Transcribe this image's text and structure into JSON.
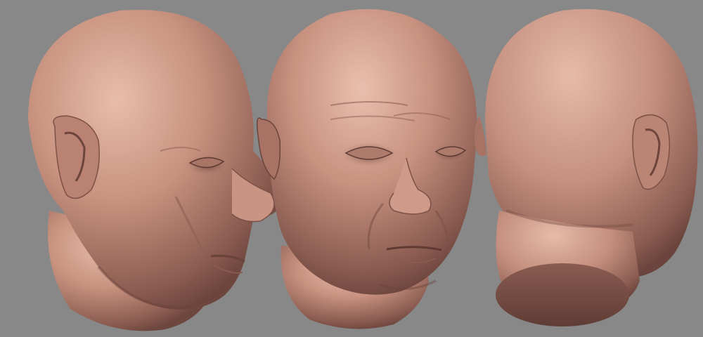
{
  "scene": {
    "background_color": "#888888",
    "subject": "sculpted-head-model",
    "views": [
      {
        "name": "three-quarter-right",
        "skin": "#c79485"
      },
      {
        "name": "front-three-quarter-left",
        "skin": "#c79485"
      },
      {
        "name": "back-three-quarter",
        "skin": "#c79485"
      }
    ],
    "colors": {
      "skin_light": "#e2b4a3",
      "skin_mid": "#c58f80",
      "skin_dark": "#7d5248",
      "shadow": "#5a3a33"
    }
  }
}
